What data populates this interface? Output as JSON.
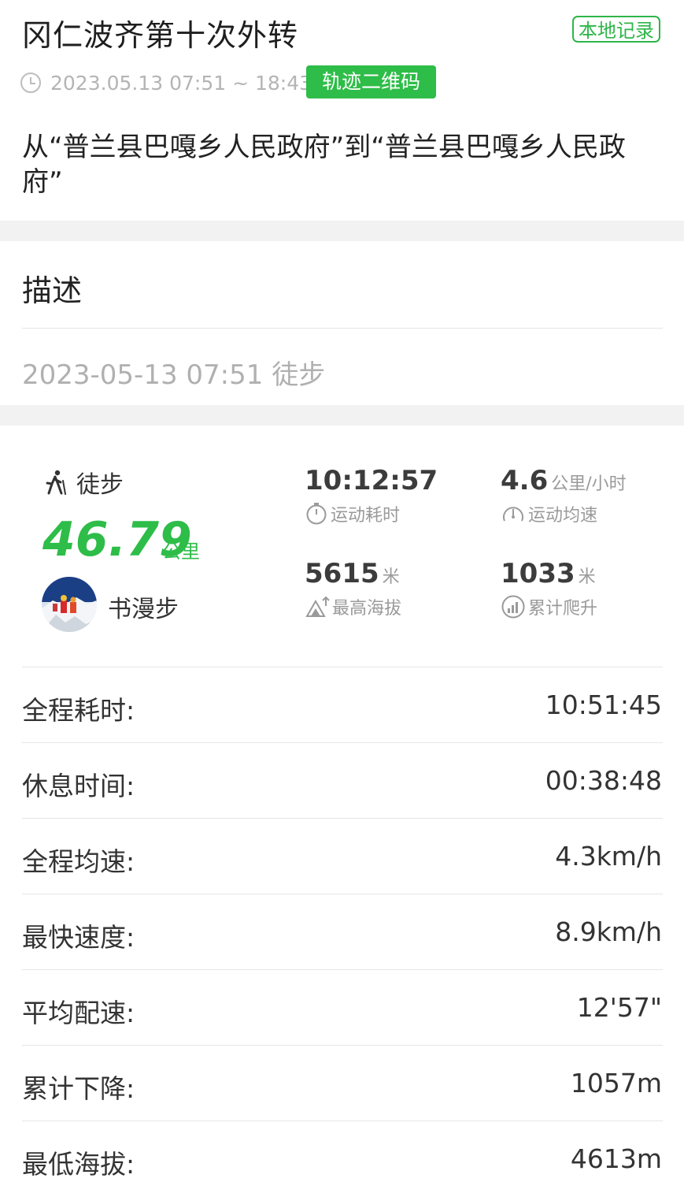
{
  "header": {
    "title": "冈仁波齐第十次外转",
    "local_badge": "本地记录",
    "time_range": "2023.05.13 07:51 ~ 18:43",
    "qr_button": "轨迹二维码",
    "route": "从“普兰县巴嘎乡人民政府”到“普兰县巴嘎乡人民政府”"
  },
  "description": {
    "heading": "描述",
    "body": "2023-05-13 07:51 徒步"
  },
  "summary": {
    "activity": "徒步",
    "distance": "46.79",
    "distance_unit": "公里",
    "user_name": "书漫步",
    "stats": [
      {
        "value": "10:12:57",
        "unit": "",
        "label": "运动耗时",
        "icon": "stopwatch-icon"
      },
      {
        "value": "4.6",
        "unit": "公里/小时",
        "label": "运动均速",
        "icon": "speed-icon"
      },
      {
        "value": "5615",
        "unit": "米",
        "label": "最高海拔",
        "icon": "altitude-icon"
      },
      {
        "value": "1033",
        "unit": "米",
        "label": "累计爬升",
        "icon": "climb-icon"
      }
    ]
  },
  "details": [
    {
      "label": "全程耗时:",
      "value": "10:51:45"
    },
    {
      "label": "休息时间:",
      "value": "00:38:48"
    },
    {
      "label": "全程均速:",
      "value": "4.3km/h"
    },
    {
      "label": "最快速度:",
      "value": "8.9km/h"
    },
    {
      "label": "平均配速:",
      "value": "12'57\""
    },
    {
      "label": "累计下降:",
      "value": "1057m"
    },
    {
      "label": "最低海拔:",
      "value": "4613m"
    }
  ],
  "colors": {
    "accent": "#2ebd48",
    "muted": "#b4b4b4",
    "divider": "#e6e6e6",
    "section_gap": "#f2f2f2"
  }
}
